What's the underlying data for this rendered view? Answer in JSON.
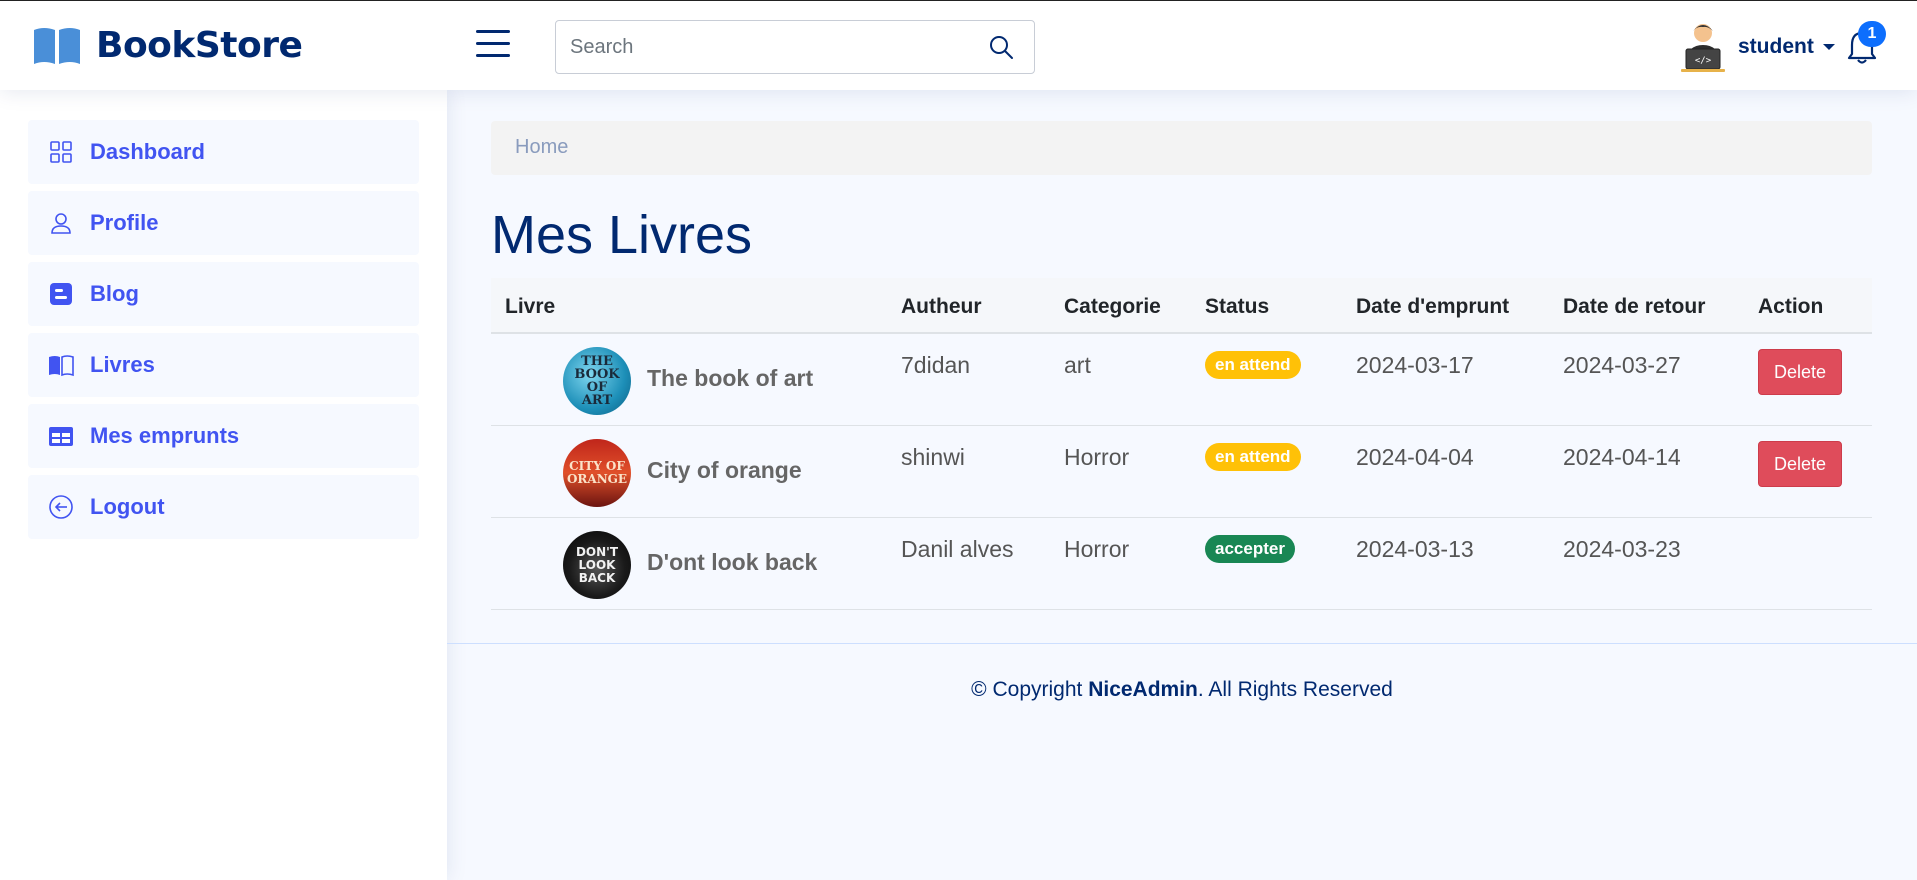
{
  "header": {
    "brand": "BookStore",
    "search_placeholder": "Search",
    "user_name": "student",
    "notification_count": "1"
  },
  "sidebar": {
    "items": [
      {
        "label": "Dashboard",
        "icon": "grid-icon"
      },
      {
        "label": "Profile",
        "icon": "person-icon"
      },
      {
        "label": "Blog",
        "icon": "blogger-icon"
      },
      {
        "label": "Livres",
        "icon": "book-icon"
      },
      {
        "label": "Mes emprunts",
        "icon": "table-icon"
      },
      {
        "label": "Logout",
        "icon": "arrow-left-circle-icon"
      }
    ]
  },
  "breadcrumb": {
    "home": "Home"
  },
  "page": {
    "title": "Mes Livres"
  },
  "table": {
    "headers": [
      "Livre",
      "Autheur",
      "Categorie",
      "Status",
      "Date d'emprunt",
      "Date de retour",
      "Action"
    ],
    "rows": [
      {
        "title": "The book of art",
        "cover_text": "THE BOOK OF ART",
        "author": "7didan",
        "category": "art",
        "status": "en attend",
        "borrow_date": "2024-03-17",
        "return_date": "2024-03-27",
        "action": "Delete"
      },
      {
        "title": "City of orange",
        "cover_text": "CITY OF ORANGE",
        "author": "shinwi",
        "category": "Horror",
        "status": "en attend",
        "borrow_date": "2024-04-04",
        "return_date": "2024-04-14",
        "action": "Delete"
      },
      {
        "title": "D'ont look back",
        "cover_text": "DON'T LOOK BACK",
        "author": "Danil alves",
        "category": "Horror",
        "status": "accepter",
        "borrow_date": "2024-03-13",
        "return_date": "2024-03-23",
        "action": ""
      }
    ]
  },
  "footer": {
    "prefix": "© Copyright ",
    "brand": "NiceAdmin",
    "suffix": ". All Rights Reserved"
  },
  "colors": {
    "primary": "#012970",
    "accent": "#4154f1",
    "warning": "#ffc107",
    "success": "#198754",
    "danger": "#dc3545",
    "badge": "#0d6efd"
  }
}
